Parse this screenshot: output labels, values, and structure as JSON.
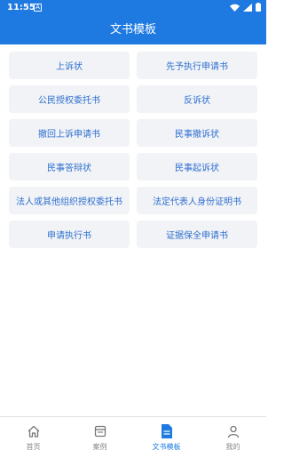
{
  "status_bar": {
    "time": "11:55",
    "notification_glyph": "A"
  },
  "header": {
    "title": "文书模板"
  },
  "documents": [
    "上诉状",
    "先予执行申请书",
    "公民授权委托书",
    "反诉状",
    "撤回上诉申请书",
    "民事撤诉状",
    "民事答辩状",
    "民事起诉状",
    "法人或其他组织授权委托书",
    "法定代表人身份证明书",
    "申请执行书",
    "证据保全申请书"
  ],
  "tabs": [
    {
      "label": "首页",
      "icon": "home-icon",
      "active": false
    },
    {
      "label": "案例",
      "icon": "case-icon",
      "active": false
    },
    {
      "label": "文书模板",
      "icon": "document-icon",
      "active": true
    },
    {
      "label": "我的",
      "icon": "profile-icon",
      "active": false
    }
  ],
  "colors": {
    "primary": "#1e7ae0",
    "card_bg": "#f1f3f6",
    "card_text": "#2f6fd0",
    "tab_inactive": "#888888"
  }
}
